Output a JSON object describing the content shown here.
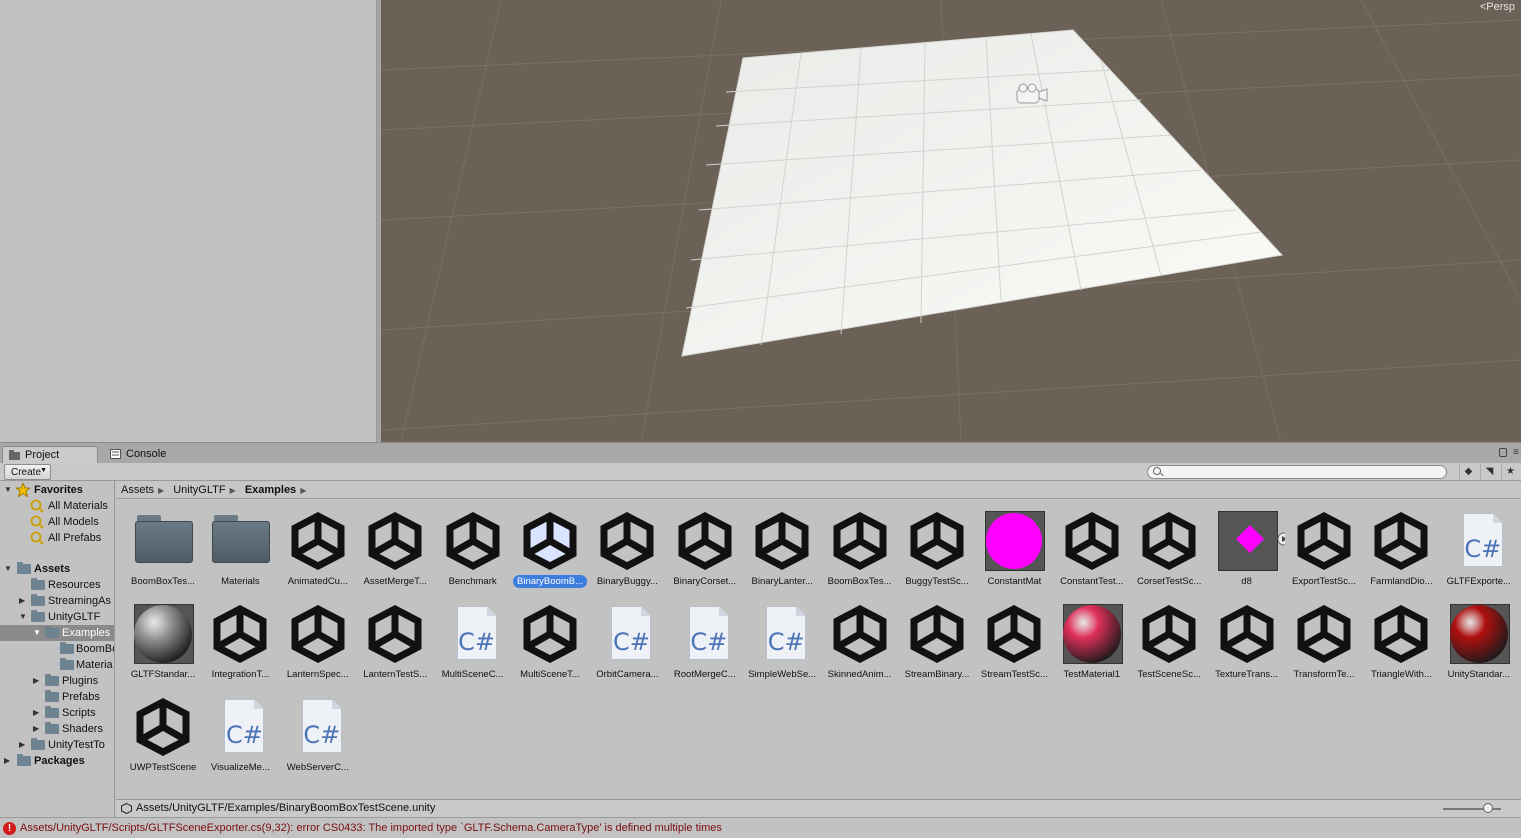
{
  "scene": {
    "persp_label": "Persp"
  },
  "tabs": {
    "project": "Project",
    "console": "Console"
  },
  "toolbar": {
    "create_label": "Create",
    "search_placeholder": ""
  },
  "tree": {
    "favorites": "Favorites",
    "all_materials": "All Materials",
    "all_models": "All Models",
    "all_prefabs": "All Prefabs",
    "assets": "Assets",
    "resources": "Resources",
    "streaming_assets": "StreamingAs",
    "unitygltf": "UnityGLTF",
    "examples": "Examples",
    "boombox": "BoomBo",
    "materials": "Materia",
    "plugins": "Plugins",
    "prefabs": "Prefabs",
    "scripts": "Scripts",
    "shaders": "Shaders",
    "unity_test_tools": "UnityTestTo",
    "packages": "Packages"
  },
  "breadcrumb": {
    "assets": "Assets",
    "unitygltf": "UnityGLTF",
    "examples": "Examples"
  },
  "assets": [
    {
      "name": "BoomBoxTes...",
      "kind": "folder"
    },
    {
      "name": "Materials",
      "kind": "folder"
    },
    {
      "name": "AnimatedCu...",
      "kind": "scene"
    },
    {
      "name": "AssetMergeT...",
      "kind": "scene"
    },
    {
      "name": "Benchmark",
      "kind": "scene"
    },
    {
      "name": "BinaryBoomB...",
      "kind": "scene-selected"
    },
    {
      "name": "BinaryBuggy...",
      "kind": "scene"
    },
    {
      "name": "BinaryCorset...",
      "kind": "scene"
    },
    {
      "name": "BinaryLanter...",
      "kind": "scene"
    },
    {
      "name": "BoomBoxTes...",
      "kind": "scene"
    },
    {
      "name": "BuggyTestSc...",
      "kind": "scene"
    },
    {
      "name": "ConstantMat",
      "kind": "material",
      "color": "#ff00ff",
      "shape": "flat"
    },
    {
      "name": "ConstantTest...",
      "kind": "scene"
    },
    {
      "name": "CorsetTestSc...",
      "kind": "scene"
    },
    {
      "name": "d8",
      "kind": "prefab"
    },
    {
      "name": "ExportTestSc...",
      "kind": "scene"
    },
    {
      "name": "FarmlandDio...",
      "kind": "scene"
    },
    {
      "name": "GLTFExporte...",
      "kind": "script"
    },
    {
      "name": "GLTFStandar...",
      "kind": "material",
      "color": "#9a9a9a",
      "shape": "sphere"
    },
    {
      "name": "IntegrationT...",
      "kind": "scene"
    },
    {
      "name": "LanternSpec...",
      "kind": "scene"
    },
    {
      "name": "LanternTestS...",
      "kind": "scene"
    },
    {
      "name": "MultiSceneC...",
      "kind": "script"
    },
    {
      "name": "MultiSceneT...",
      "kind": "scene"
    },
    {
      "name": "OrbitCamera...",
      "kind": "script"
    },
    {
      "name": "RootMergeC...",
      "kind": "script"
    },
    {
      "name": "SimpleWebSe...",
      "kind": "script"
    },
    {
      "name": "SkinnedAnim...",
      "kind": "scene"
    },
    {
      "name": "StreamBinary...",
      "kind": "scene"
    },
    {
      "name": "StreamTestSc...",
      "kind": "scene"
    },
    {
      "name": "TestMaterial1",
      "kind": "material",
      "color": "#e0305a",
      "shape": "sphere"
    },
    {
      "name": "TestSceneSc...",
      "kind": "scene"
    },
    {
      "name": "TextureTrans...",
      "kind": "scene"
    },
    {
      "name": "TransformTe...",
      "kind": "scene"
    },
    {
      "name": "TriangleWith...",
      "kind": "scene"
    },
    {
      "name": "UnityStandar...",
      "kind": "material",
      "color": "#b01010",
      "shape": "sphere"
    },
    {
      "name": "UWPTestScene",
      "kind": "scene"
    },
    {
      "name": "VisualizeMe...",
      "kind": "script"
    },
    {
      "name": "WebServerC...",
      "kind": "script"
    }
  ],
  "cs_label": "C#",
  "pathbar": {
    "path": "Assets/UnityGLTF/Examples/BinaryBoomBoxTestScene.unity"
  },
  "status": {
    "error": "Assets/UnityGLTF/Scripts/GLTFSceneExporter.cs(9,32): error CS0433: The imported type `GLTF.Schema.CameraType' is defined multiple times"
  },
  "colors": {
    "scene_bg": "#6b6157",
    "plane": "#eef0ec",
    "selection": "#3e7de0",
    "error": "#d21b1b"
  }
}
